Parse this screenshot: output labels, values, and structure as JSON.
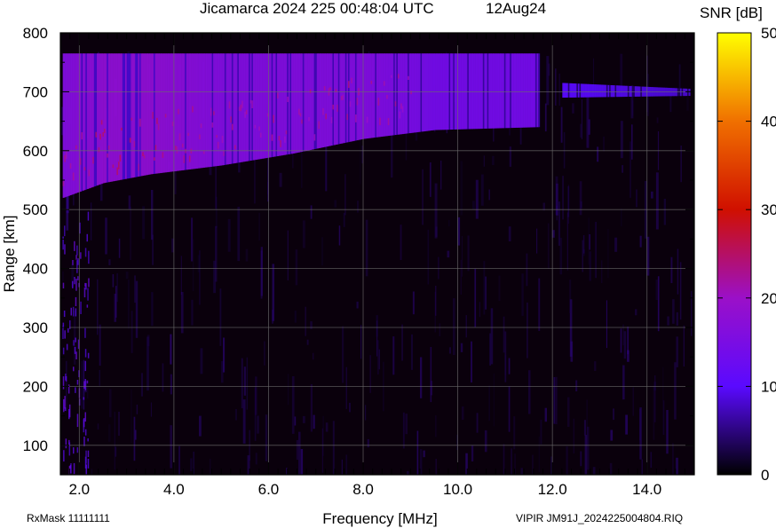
{
  "title": "Jicamarca 2024 225 00:48:04 UTC",
  "date": "12Aug24",
  "footer_left": "RxMask 11111111",
  "footer_right": "VIPIR  JM91J_2024225004804.RIQ",
  "chart_data": {
    "type": "heatmap",
    "xlabel": "Frequency [MHz]",
    "ylabel": "Range [km]",
    "xlim": [
      1.6,
      15.0
    ],
    "ylim": [
      50,
      800
    ],
    "x_ticks": [
      {
        "value": 2.0,
        "label": "2.0"
      },
      {
        "value": 4.0,
        "label": "4.0"
      },
      {
        "value": 6.0,
        "label": "6.0"
      },
      {
        "value": 8.0,
        "label": "8.0"
      },
      {
        "value": 10.0,
        "label": "10.0"
      },
      {
        "value": 12.0,
        "label": "12.0"
      },
      {
        "value": 14.0,
        "label": "14.0"
      }
    ],
    "y_ticks": [
      {
        "value": 100,
        "label": "100"
      },
      {
        "value": 200,
        "label": "200"
      },
      {
        "value": 300,
        "label": "300"
      },
      {
        "value": 400,
        "label": "400"
      },
      {
        "value": 500,
        "label": "500"
      },
      {
        "value": 600,
        "label": "600"
      },
      {
        "value": 700,
        "label": "700"
      },
      {
        "value": 800,
        "label": "800"
      }
    ],
    "grid": true,
    "colorbar": {
      "label": "SNR [dB]",
      "range": [
        0,
        50
      ],
      "ticks": [
        {
          "value": 0,
          "label": "0"
        },
        {
          "value": 10,
          "label": "10"
        },
        {
          "value": 20,
          "label": "20"
        },
        {
          "value": 30,
          "label": "30"
        },
        {
          "value": 40,
          "label": "40"
        },
        {
          "value": 50,
          "label": "50"
        }
      ],
      "stops": [
        {
          "value": 0,
          "color": "#000000"
        },
        {
          "value": 10,
          "color": "#5a0aff"
        },
        {
          "value": 20,
          "color": "#9b10c8"
        },
        {
          "value": 30,
          "color": "#d01000"
        },
        {
          "value": 40,
          "color": "#f07000"
        },
        {
          "value": 50,
          "color": "#ffff00"
        }
      ]
    },
    "echo_trace": [
      {
        "freq": 1.65,
        "range_bottom": 520,
        "range_top": 765,
        "snr": 16
      },
      {
        "freq": 2.5,
        "range_bottom": 545,
        "range_top": 765,
        "snr": 18
      },
      {
        "freq": 3.5,
        "range_bottom": 560,
        "range_top": 765,
        "snr": 18
      },
      {
        "freq": 5.0,
        "range_bottom": 575,
        "range_top": 765,
        "snr": 16
      },
      {
        "freq": 6.5,
        "range_bottom": 595,
        "range_top": 765,
        "snr": 16
      },
      {
        "freq": 8.0,
        "range_bottom": 620,
        "range_top": 765,
        "snr": 16
      },
      {
        "freq": 9.5,
        "range_bottom": 635,
        "range_top": 765,
        "snr": 14
      },
      {
        "freq": 11.7,
        "range_bottom": 640,
        "range_top": 765,
        "snr": 14
      },
      {
        "freq": 12.2,
        "range_bottom": 690,
        "range_top": 715,
        "snr": 10
      },
      {
        "freq": 14.9,
        "range_bottom": 693,
        "range_top": 705,
        "snr": 8
      }
    ]
  }
}
